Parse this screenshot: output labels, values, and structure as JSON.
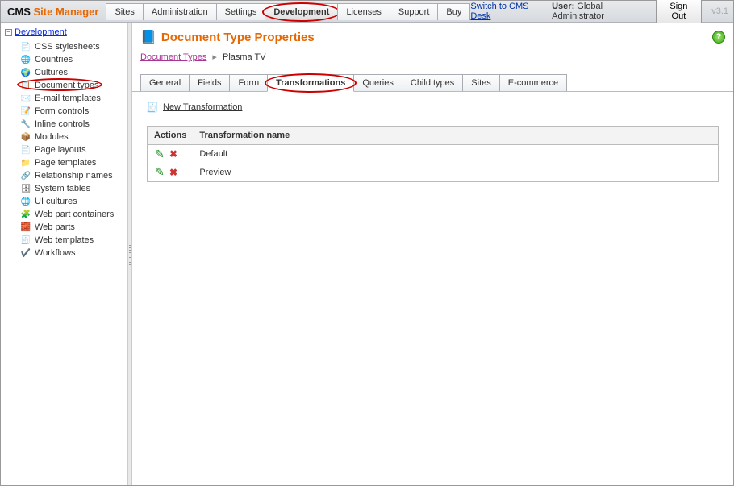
{
  "logo": {
    "p1": "CMS",
    "p2": "Site Manager"
  },
  "topNav": {
    "tabs": [
      {
        "label": "Sites",
        "active": false
      },
      {
        "label": "Administration",
        "active": false
      },
      {
        "label": "Settings",
        "active": false
      },
      {
        "label": "Development",
        "active": true,
        "highlighted": true
      },
      {
        "label": "Licenses",
        "active": false
      },
      {
        "label": "Support",
        "active": false
      },
      {
        "label": "Buy",
        "active": false
      }
    ],
    "switchDesk": "Switch to CMS Desk",
    "userLabel": "User:",
    "userName": "Global Administrator",
    "signOut": "Sign Out",
    "version": "v3.1"
  },
  "sidebar": {
    "root": "Development",
    "items": [
      {
        "icon": "📄",
        "label": "CSS stylesheets"
      },
      {
        "icon": "🌐",
        "label": "Countries"
      },
      {
        "icon": "🌍",
        "label": "Cultures"
      },
      {
        "icon": "📋",
        "label": "Document types",
        "highlighted": true
      },
      {
        "icon": "✉️",
        "label": "E-mail templates"
      },
      {
        "icon": "📝",
        "label": "Form controls"
      },
      {
        "icon": "🔧",
        "label": "Inline controls"
      },
      {
        "icon": "📦",
        "label": "Modules"
      },
      {
        "icon": "📄",
        "label": "Page layouts"
      },
      {
        "icon": "📁",
        "label": "Page templates"
      },
      {
        "icon": "🔗",
        "label": "Relationship names"
      },
      {
        "icon": "🗄",
        "label": "System tables"
      },
      {
        "icon": "🌐",
        "label": "UI cultures"
      },
      {
        "icon": "🧩",
        "label": "Web part containers"
      },
      {
        "icon": "🧱",
        "label": "Web parts"
      },
      {
        "icon": "🧾",
        "label": "Web templates"
      },
      {
        "icon": "✔️",
        "label": "Workflows"
      }
    ]
  },
  "main": {
    "title": "Document Type Properties",
    "breadcrumb": {
      "link": "Document Types",
      "current": "Plasma TV"
    },
    "detailTabs": [
      {
        "label": "General"
      },
      {
        "label": "Fields"
      },
      {
        "label": "Form"
      },
      {
        "label": "Transformations",
        "active": true,
        "highlighted": true
      },
      {
        "label": "Queries"
      },
      {
        "label": "Child types"
      },
      {
        "label": "Sites"
      },
      {
        "label": "E-commerce"
      }
    ],
    "newTransformation": "New Transformation",
    "table": {
      "colActions": "Actions",
      "colName": "Transformation name",
      "rows": [
        {
          "name": "Default"
        },
        {
          "name": "Preview"
        }
      ]
    }
  }
}
